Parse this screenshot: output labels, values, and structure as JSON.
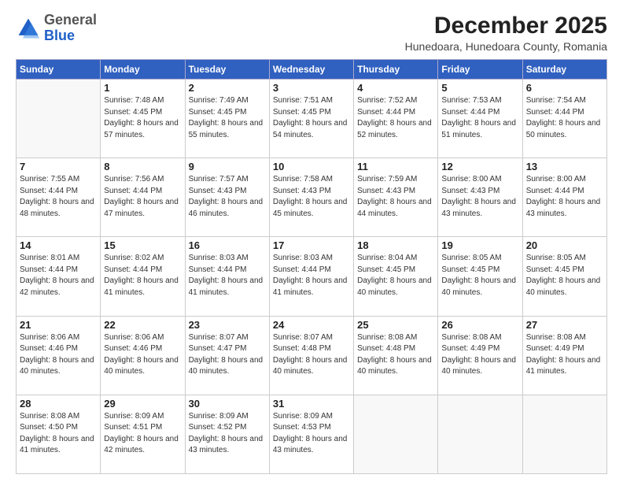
{
  "logo": {
    "general": "General",
    "blue": "Blue"
  },
  "title": {
    "main": "December 2025",
    "sub": "Hunedoara, Hunedoara County, Romania"
  },
  "header": {
    "days": [
      "Sunday",
      "Monday",
      "Tuesday",
      "Wednesday",
      "Thursday",
      "Friday",
      "Saturday"
    ]
  },
  "weeks": [
    [
      {
        "empty": true
      },
      {
        "day": 1,
        "sunrise": "7:48 AM",
        "sunset": "4:45 PM",
        "daylight": "8 hours and 57 minutes."
      },
      {
        "day": 2,
        "sunrise": "7:49 AM",
        "sunset": "4:45 PM",
        "daylight": "8 hours and 55 minutes."
      },
      {
        "day": 3,
        "sunrise": "7:51 AM",
        "sunset": "4:45 PM",
        "daylight": "8 hours and 54 minutes."
      },
      {
        "day": 4,
        "sunrise": "7:52 AM",
        "sunset": "4:44 PM",
        "daylight": "8 hours and 52 minutes."
      },
      {
        "day": 5,
        "sunrise": "7:53 AM",
        "sunset": "4:44 PM",
        "daylight": "8 hours and 51 minutes."
      },
      {
        "day": 6,
        "sunrise": "7:54 AM",
        "sunset": "4:44 PM",
        "daylight": "8 hours and 50 minutes."
      }
    ],
    [
      {
        "day": 7,
        "sunrise": "7:55 AM",
        "sunset": "4:44 PM",
        "daylight": "8 hours and 48 minutes."
      },
      {
        "day": 8,
        "sunrise": "7:56 AM",
        "sunset": "4:44 PM",
        "daylight": "8 hours and 47 minutes."
      },
      {
        "day": 9,
        "sunrise": "7:57 AM",
        "sunset": "4:43 PM",
        "daylight": "8 hours and 46 minutes."
      },
      {
        "day": 10,
        "sunrise": "7:58 AM",
        "sunset": "4:43 PM",
        "daylight": "8 hours and 45 minutes."
      },
      {
        "day": 11,
        "sunrise": "7:59 AM",
        "sunset": "4:43 PM",
        "daylight": "8 hours and 44 minutes."
      },
      {
        "day": 12,
        "sunrise": "8:00 AM",
        "sunset": "4:43 PM",
        "daylight": "8 hours and 43 minutes."
      },
      {
        "day": 13,
        "sunrise": "8:00 AM",
        "sunset": "4:44 PM",
        "daylight": "8 hours and 43 minutes."
      }
    ],
    [
      {
        "day": 14,
        "sunrise": "8:01 AM",
        "sunset": "4:44 PM",
        "daylight": "8 hours and 42 minutes."
      },
      {
        "day": 15,
        "sunrise": "8:02 AM",
        "sunset": "4:44 PM",
        "daylight": "8 hours and 41 minutes."
      },
      {
        "day": 16,
        "sunrise": "8:03 AM",
        "sunset": "4:44 PM",
        "daylight": "8 hours and 41 minutes."
      },
      {
        "day": 17,
        "sunrise": "8:03 AM",
        "sunset": "4:44 PM",
        "daylight": "8 hours and 41 minutes."
      },
      {
        "day": 18,
        "sunrise": "8:04 AM",
        "sunset": "4:45 PM",
        "daylight": "8 hours and 40 minutes."
      },
      {
        "day": 19,
        "sunrise": "8:05 AM",
        "sunset": "4:45 PM",
        "daylight": "8 hours and 40 minutes."
      },
      {
        "day": 20,
        "sunrise": "8:05 AM",
        "sunset": "4:45 PM",
        "daylight": "8 hours and 40 minutes."
      }
    ],
    [
      {
        "day": 21,
        "sunrise": "8:06 AM",
        "sunset": "4:46 PM",
        "daylight": "8 hours and 40 minutes."
      },
      {
        "day": 22,
        "sunrise": "8:06 AM",
        "sunset": "4:46 PM",
        "daylight": "8 hours and 40 minutes."
      },
      {
        "day": 23,
        "sunrise": "8:07 AM",
        "sunset": "4:47 PM",
        "daylight": "8 hours and 40 minutes."
      },
      {
        "day": 24,
        "sunrise": "8:07 AM",
        "sunset": "4:48 PM",
        "daylight": "8 hours and 40 minutes."
      },
      {
        "day": 25,
        "sunrise": "8:08 AM",
        "sunset": "4:48 PM",
        "daylight": "8 hours and 40 minutes."
      },
      {
        "day": 26,
        "sunrise": "8:08 AM",
        "sunset": "4:49 PM",
        "daylight": "8 hours and 40 minutes."
      },
      {
        "day": 27,
        "sunrise": "8:08 AM",
        "sunset": "4:49 PM",
        "daylight": "8 hours and 41 minutes."
      }
    ],
    [
      {
        "day": 28,
        "sunrise": "8:08 AM",
        "sunset": "4:50 PM",
        "daylight": "8 hours and 41 minutes."
      },
      {
        "day": 29,
        "sunrise": "8:09 AM",
        "sunset": "4:51 PM",
        "daylight": "8 hours and 42 minutes."
      },
      {
        "day": 30,
        "sunrise": "8:09 AM",
        "sunset": "4:52 PM",
        "daylight": "8 hours and 43 minutes."
      },
      {
        "day": 31,
        "sunrise": "8:09 AM",
        "sunset": "4:53 PM",
        "daylight": "8 hours and 43 minutes."
      },
      {
        "empty": true
      },
      {
        "empty": true
      },
      {
        "empty": true
      }
    ]
  ]
}
